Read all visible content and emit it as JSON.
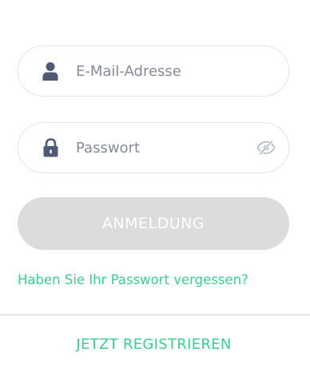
{
  "login_form": {
    "email": {
      "value": "",
      "placeholder": "E-Mail-Adresse",
      "icon": "user-icon"
    },
    "password": {
      "value": "",
      "placeholder": "Passwort",
      "icon": "lock-icon",
      "toggle_icon": "eye-slash-icon"
    },
    "submit_label": "ANMELDUNG",
    "forgot_password_label": "Haben Sie Ihr Passwort vergessen?"
  },
  "footer": {
    "register_label": "JETZT REGISTRIEREN"
  },
  "colors": {
    "accent": "#3ccf8e",
    "icon": "#4f5a77",
    "button_disabled": "#dcdcdc",
    "placeholder": "#858b9c"
  }
}
